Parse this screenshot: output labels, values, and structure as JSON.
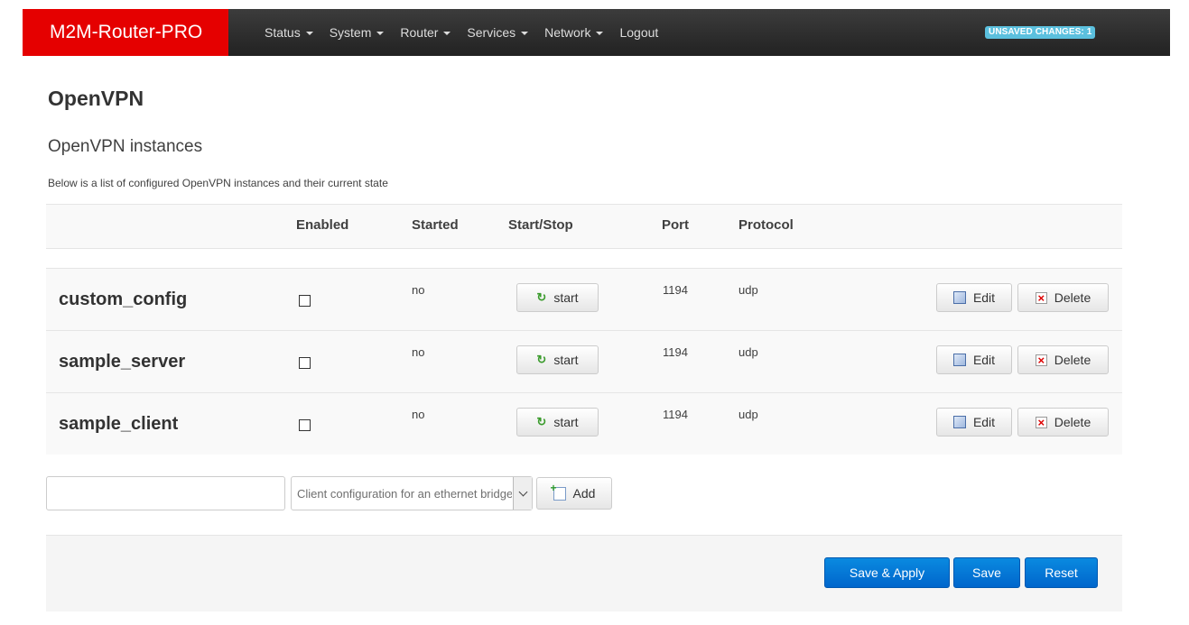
{
  "navbar": {
    "brand": "M2M-Router-PRO",
    "items": [
      {
        "label": "Status",
        "dropdown": true
      },
      {
        "label": "System",
        "dropdown": true
      },
      {
        "label": "Router",
        "dropdown": true
      },
      {
        "label": "Services",
        "dropdown": true
      },
      {
        "label": "Network",
        "dropdown": true
      },
      {
        "label": "Logout",
        "dropdown": false
      }
    ],
    "unsaved_badge": "UNSAVED CHANGES: 1",
    "colors": {
      "brand_bg": "#e50000",
      "badge_bg": "#5bc0de"
    }
  },
  "page": {
    "title": "OpenVPN",
    "section_title": "OpenVPN instances",
    "description": "Below is a list of configured OpenVPN instances and their current state"
  },
  "table": {
    "headers": {
      "enabled": "Enabled",
      "started": "Started",
      "start_stop": "Start/Stop",
      "port": "Port",
      "protocol": "Protocol"
    },
    "rows": [
      {
        "name": "custom_config",
        "enabled": false,
        "started": "no",
        "action": "start",
        "port": "1194",
        "protocol": "udp",
        "edit": "Edit",
        "delete": "Delete"
      },
      {
        "name": "sample_server",
        "enabled": false,
        "started": "no",
        "action": "start",
        "port": "1194",
        "protocol": "udp",
        "edit": "Edit",
        "delete": "Delete"
      },
      {
        "name": "sample_client",
        "enabled": false,
        "started": "no",
        "action": "start",
        "port": "1194",
        "protocol": "udp",
        "edit": "Edit",
        "delete": "Delete"
      }
    ]
  },
  "add_form": {
    "name_value": "",
    "template_selected": "Client configuration for an ethernet bridge VPN",
    "add_label": "Add"
  },
  "footer": {
    "save_apply": "Save & Apply",
    "save": "Save",
    "reset": "Reset"
  }
}
